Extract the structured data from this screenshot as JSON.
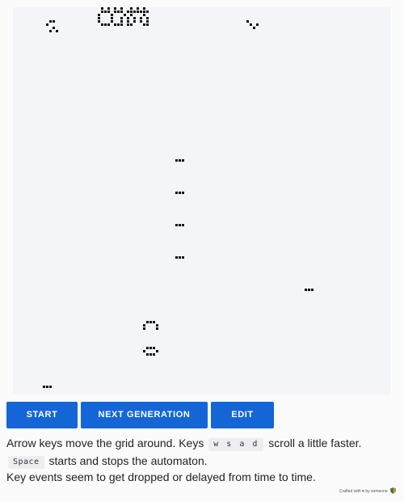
{
  "board": {
    "cell_color": "#111111",
    "background_color": "#f3f5f8",
    "live_cell_groups": [
      {
        "name": "top-cluster",
        "cells": [
          [
            27,
            -1
          ],
          [
            29,
            -1
          ],
          [
            31,
            -1
          ],
          [
            33,
            -1
          ],
          [
            36,
            -1
          ],
          [
            38,
            -1
          ],
          [
            40,
            -1
          ],
          [
            27,
            0
          ],
          [
            28,
            0
          ],
          [
            29,
            0
          ],
          [
            31,
            0
          ],
          [
            32,
            0
          ],
          [
            33,
            0
          ],
          [
            35,
            0
          ],
          [
            36,
            0
          ],
          [
            37,
            0
          ],
          [
            38,
            0
          ],
          [
            39,
            0
          ],
          [
            40,
            0
          ],
          [
            41,
            0
          ],
          [
            26,
            1
          ],
          [
            30,
            1
          ],
          [
            34,
            1
          ],
          [
            36,
            1
          ],
          [
            40,
            1
          ],
          [
            26,
            2
          ],
          [
            30,
            2
          ],
          [
            33,
            2
          ],
          [
            35,
            2
          ],
          [
            37,
            2
          ],
          [
            39,
            2
          ],
          [
            41,
            2
          ],
          [
            26,
            3
          ],
          [
            30,
            3
          ],
          [
            33,
            3
          ],
          [
            35,
            3
          ],
          [
            37,
            3
          ],
          [
            39,
            3
          ],
          [
            41,
            3
          ],
          [
            27,
            4
          ],
          [
            28,
            4
          ],
          [
            29,
            4
          ],
          [
            31,
            4
          ],
          [
            32,
            4
          ],
          [
            33,
            4
          ],
          [
            35,
            4
          ],
          [
            36,
            4
          ],
          [
            40,
            4
          ],
          [
            41,
            4
          ]
        ]
      },
      {
        "name": "left-glider",
        "cells": [
          [
            11,
            3
          ],
          [
            12,
            3
          ],
          [
            10,
            4
          ],
          [
            12,
            5
          ],
          [
            11,
            6
          ],
          [
            13,
            6
          ]
        ]
      },
      {
        "name": "right-small",
        "cells": [
          [
            72,
            3
          ],
          [
            73,
            4
          ],
          [
            75,
            4
          ],
          [
            74,
            5
          ]
        ]
      },
      {
        "name": "blinker-1",
        "cells": [
          [
            50,
            46
          ],
          [
            51,
            46
          ],
          [
            52,
            46
          ]
        ]
      },
      {
        "name": "blinker-2",
        "cells": [
          [
            50,
            56
          ],
          [
            51,
            56
          ],
          [
            52,
            56
          ]
        ]
      },
      {
        "name": "blinker-3",
        "cells": [
          [
            50,
            66
          ],
          [
            51,
            66
          ],
          [
            52,
            66
          ]
        ]
      },
      {
        "name": "blinker-4",
        "cells": [
          [
            50,
            76
          ],
          [
            51,
            76
          ],
          [
            52,
            76
          ]
        ]
      },
      {
        "name": "blinker-5",
        "cells": [
          [
            90,
            86
          ],
          [
            91,
            86
          ],
          [
            92,
            86
          ]
        ]
      },
      {
        "name": "arch",
        "cells": [
          [
            41,
            96
          ],
          [
            42,
            96
          ],
          [
            43,
            96
          ],
          [
            40,
            97
          ],
          [
            44,
            97
          ],
          [
            40,
            98
          ],
          [
            44,
            98
          ]
        ]
      },
      {
        "name": "ring",
        "cells": [
          [
            41,
            104
          ],
          [
            42,
            104
          ],
          [
            43,
            104
          ],
          [
            40,
            105
          ],
          [
            44,
            105
          ],
          [
            41,
            106
          ],
          [
            42,
            106
          ],
          [
            43,
            106
          ]
        ]
      },
      {
        "name": "blinker-6",
        "cells": [
          [
            9,
            116
          ],
          [
            10,
            116
          ],
          [
            11,
            116
          ]
        ]
      }
    ]
  },
  "buttons": {
    "start": "START",
    "next_generation": "NEXT GENERATION",
    "edit": "EDIT"
  },
  "help": {
    "line1_prefix": "Arrow keys move the grid around. Keys",
    "line1_keys": "w s a d",
    "line1_suffix": "scroll a little faster.",
    "line2_key": "Space",
    "line2_suffix": "starts and stops the automaton.",
    "line3": "Key events seem to get dropped or delayed from time to time."
  },
  "footer": {
    "credit": "Crafted with ♥ by someone"
  },
  "colors": {
    "button": "#1466d6",
    "button_text": "#ffffff",
    "grid_background": "#f3f5f8",
    "page_background": "#fbfbfc"
  }
}
